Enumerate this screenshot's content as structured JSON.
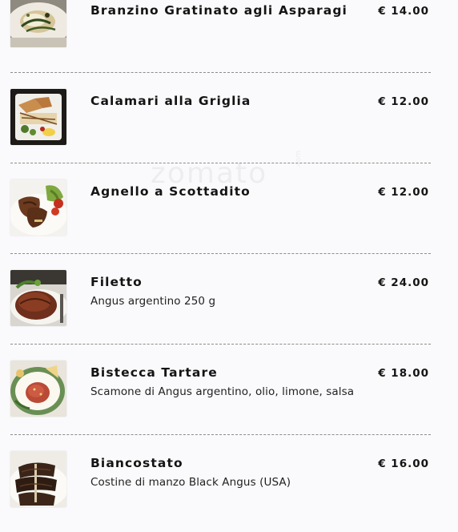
{
  "watermark": {
    "text": "zomato",
    "suffix": ".com"
  },
  "menu": {
    "items": [
      {
        "name": "Branzino Gratinato agli Asparagi",
        "description": "",
        "price": "€ 14.00",
        "photo_icon": "sea-bass-dish-photo"
      },
      {
        "name": "Calamari alla Griglia",
        "description": "",
        "price": "€ 12.00",
        "photo_icon": "grilled-calamari-photo"
      },
      {
        "name": "Agnello a Scottadito",
        "description": "",
        "price": "€ 12.00",
        "photo_icon": "lamb-chops-photo"
      },
      {
        "name": "Filetto",
        "description": "Angus argentino 250 g",
        "price": "€ 24.00",
        "photo_icon": "beef-fillet-photo"
      },
      {
        "name": "Bistecca Tartare",
        "description": "Scamone di Angus argentino, olio, limone, salsa",
        "price": "€ 18.00",
        "photo_icon": "beef-tartare-photo"
      },
      {
        "name": "Biancostato",
        "description": "Costine di manzo Black Angus (USA)",
        "price": "€ 16.00",
        "photo_icon": "short-ribs-photo"
      }
    ]
  }
}
